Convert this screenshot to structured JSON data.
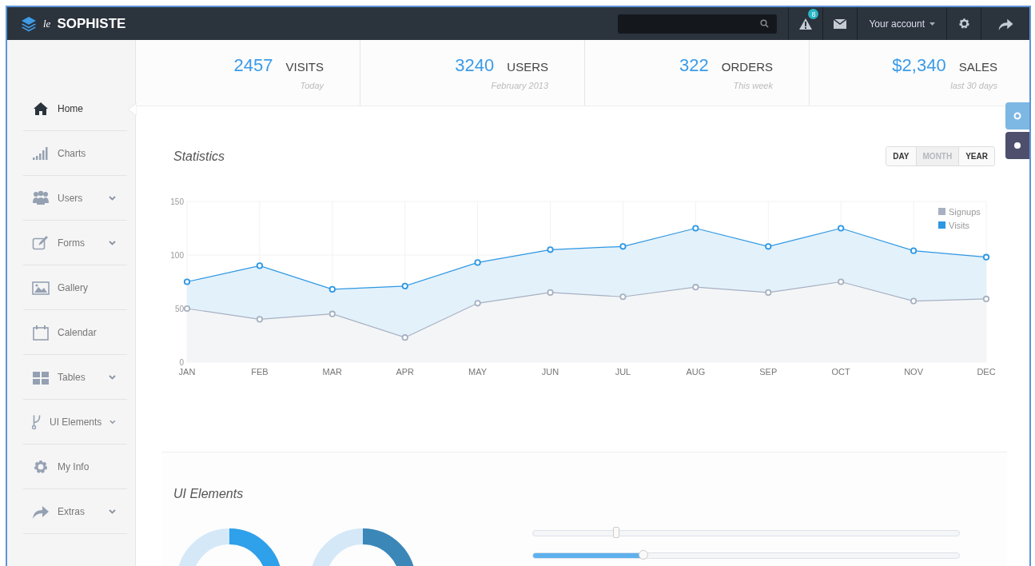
{
  "brand": {
    "prefix": "le",
    "name": "SOPHISTE"
  },
  "topbar": {
    "alerts_badge": "8",
    "account": "Your account"
  },
  "sidebar": {
    "items": [
      {
        "label": "Home",
        "selected": true,
        "expandable": false
      },
      {
        "label": "Charts",
        "selected": false,
        "expandable": false
      },
      {
        "label": "Users",
        "selected": false,
        "expandable": true
      },
      {
        "label": "Forms",
        "selected": false,
        "expandable": true
      },
      {
        "label": "Gallery",
        "selected": false,
        "expandable": false
      },
      {
        "label": "Calendar",
        "selected": false,
        "expandable": false
      },
      {
        "label": "Tables",
        "selected": false,
        "expandable": true
      },
      {
        "label": "UI Elements",
        "selected": false,
        "expandable": true
      },
      {
        "label": "My Info",
        "selected": false,
        "expandable": false
      },
      {
        "label": "Extras",
        "selected": false,
        "expandable": true
      }
    ]
  },
  "stats": [
    {
      "value": "2457",
      "label": "VISITS",
      "period": "Today"
    },
    {
      "value": "3240",
      "label": "USERS",
      "period": "February 2013"
    },
    {
      "value": "322",
      "label": "ORDERS",
      "period": "This week"
    },
    {
      "value": "$2,340",
      "label": "SALES",
      "period": "last 30 days"
    }
  ],
  "theme_swatches": [
    {
      "color": "#7db7e4"
    },
    {
      "color": "#4d4f6d"
    }
  ],
  "statistics": {
    "title": "Statistics",
    "ranges": [
      {
        "label": "DAY",
        "selected": false
      },
      {
        "label": "MONTH",
        "selected": true
      },
      {
        "label": "YEAR",
        "selected": false
      }
    ],
    "chart_data": {
      "type": "area",
      "grid": true,
      "legend": true,
      "categories": [
        "JAN",
        "FEB",
        "MAR",
        "APR",
        "MAY",
        "JUN",
        "JUL",
        "AUG",
        "SEP",
        "OCT",
        "NOV",
        "DEC"
      ],
      "ylim": [
        0,
        150
      ],
      "yticks": [
        0,
        50,
        100,
        150
      ],
      "series": [
        {
          "name": "Signups",
          "color": "#a7b1c2",
          "values": [
            50,
            40,
            45,
            23,
            55,
            65,
            61,
            70,
            65,
            75,
            57,
            59
          ]
        },
        {
          "name": "Visits",
          "color": "#2d97e3",
          "values": [
            75,
            90,
            68,
            71,
            93,
            105,
            108,
            125,
            108,
            125,
            104,
            98
          ]
        }
      ]
    }
  },
  "ui_elements": {
    "title": "UI Elements",
    "sliders": [
      {
        "kind": "handle",
        "level": 0.195
      },
      {
        "kind": "range",
        "level": 0.258
      }
    ]
  }
}
